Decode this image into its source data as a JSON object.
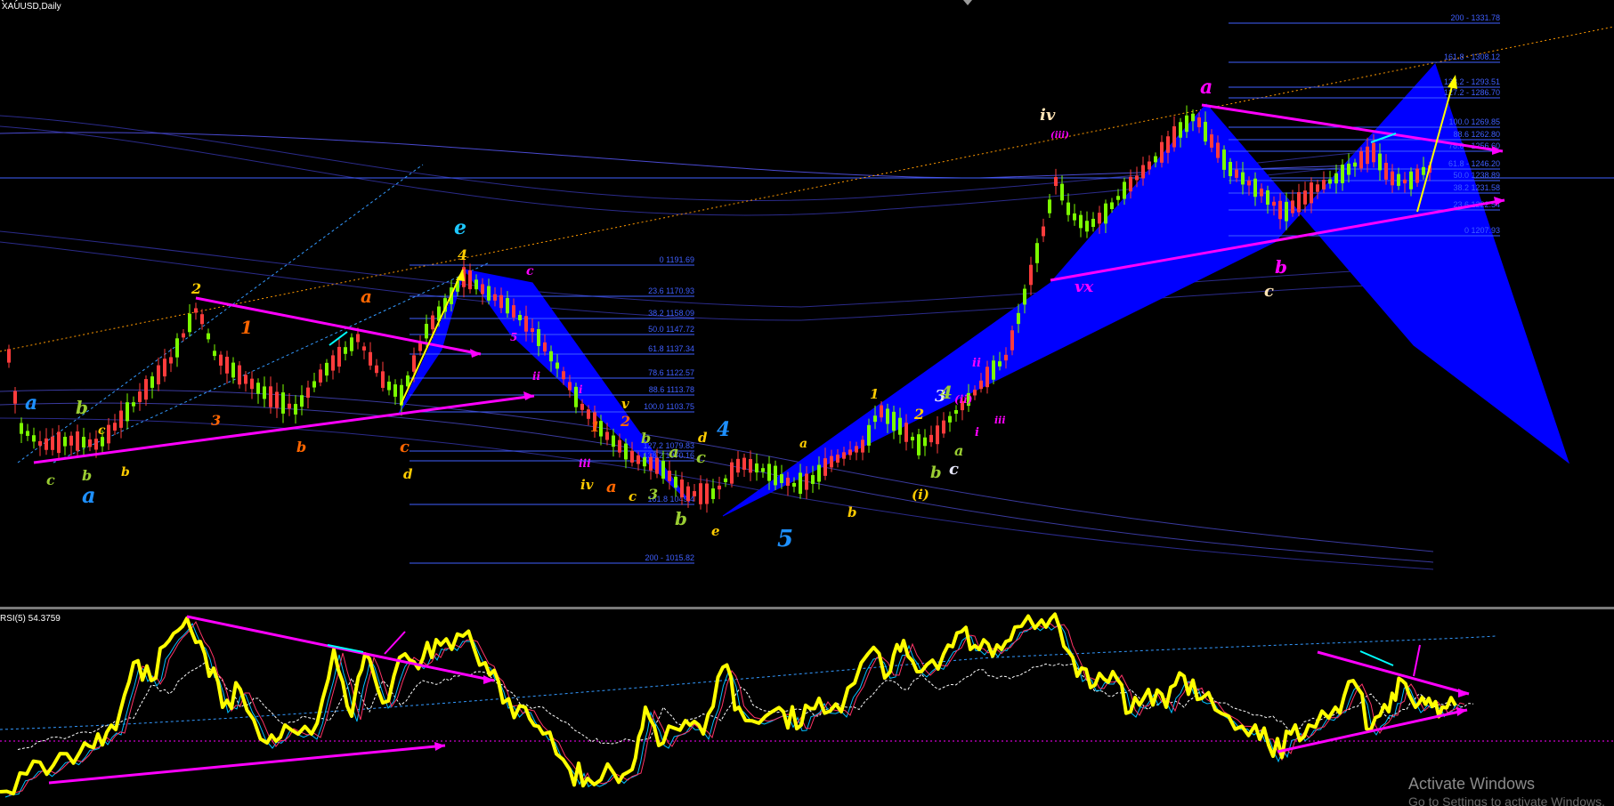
{
  "chart": {
    "title": "XAUUSD,Daily",
    "symbol": "XAUUSD",
    "timeframe": "Daily"
  },
  "indicator": {
    "title": "RSI(5) 54.3759",
    "name": "RSI(5)",
    "value": 54.3759
  },
  "watermark": {
    "line1": "Activate Windows",
    "line2": "Go to Settings to activate Windows."
  },
  "fib_left": [
    "0 1191.69",
    "23.6 1170.93",
    "38.2 1158.09",
    "50.0 1147.72",
    "61.8 1137.34",
    "78.6 1122.57",
    "88.6 1113.78",
    "100.0 1103.75",
    "127.2 1079.83",
    "138.2 1070.16",
    "161.8 1049.4",
    "200 - 1015.82"
  ],
  "fib_right": [
    "200 - 1331.78",
    "161.8 - 1308.12",
    "138.2 - 1293.51",
    "127.2 - 1286.70",
    "100.0 1269.85",
    "88.6 1262.80",
    "78.6 - 1256.60",
    "61.8 - 1246.20",
    "50.0 1238.89",
    "38.2 1231.58",
    "23.6 1222.54",
    "0 1207.93"
  ],
  "wave_labels": [
    "a",
    "b",
    "c",
    "b",
    "a",
    "b",
    "c",
    "2",
    "1",
    "3",
    "b",
    "a",
    "c",
    "d",
    "e",
    "4",
    "c",
    "5",
    "ii",
    "i",
    "iii",
    "iv",
    "v",
    "1",
    "2",
    "a",
    "c",
    "b",
    "3",
    "a",
    "b",
    "c",
    "d",
    "e",
    "4",
    "5",
    "a",
    "b",
    "1",
    "2",
    "3",
    "(i)",
    "4",
    "b",
    "a",
    "c",
    "(ii)",
    "i",
    "ii",
    "iii",
    "iv",
    "(iii)",
    "vx",
    "a",
    "b",
    "c",
    "(iv)"
  ],
  "colors": {
    "background": "#000000",
    "pattern_fill": "#0000ff",
    "trendline": "#ff00ff",
    "fib_line": "#3f5fff",
    "rsi_line": "#ffff00",
    "bull_candle": "#7cfc00",
    "bear_candle": "#ff3c3c"
  }
}
